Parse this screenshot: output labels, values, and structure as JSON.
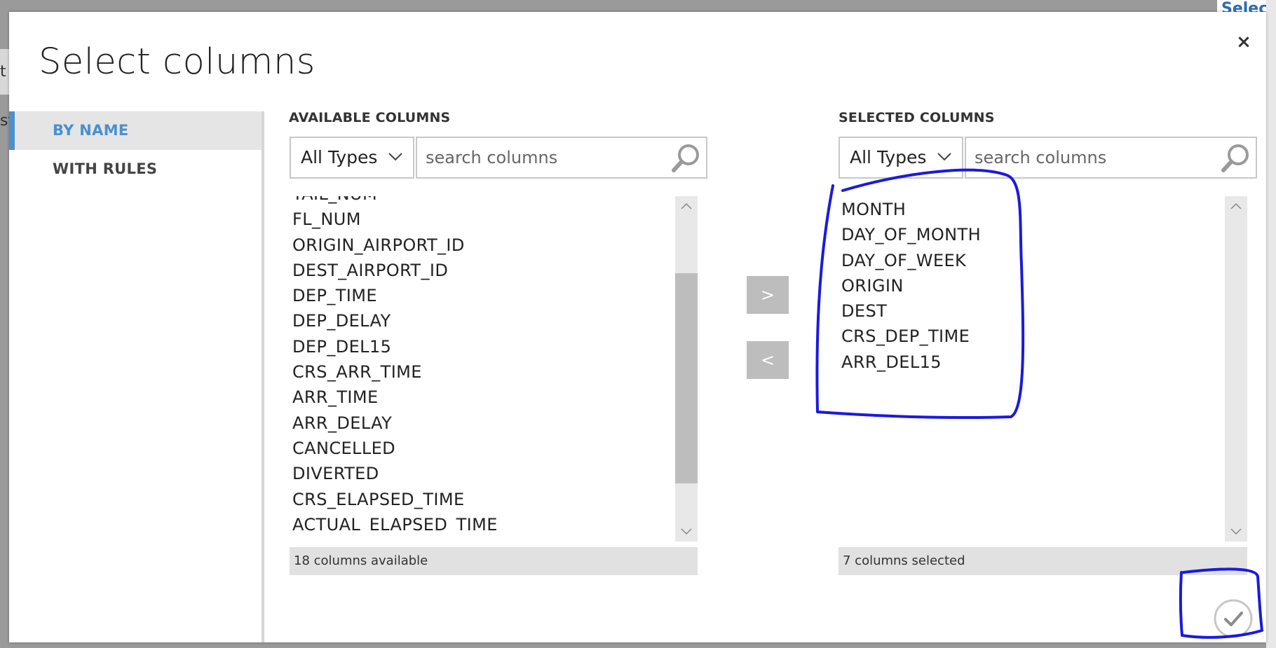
{
  "dialog": {
    "title": "Select columns",
    "close_label": "×"
  },
  "nav": {
    "items": [
      {
        "label": "BY NAME",
        "active": true
      },
      {
        "label": "WITH RULES",
        "active": false
      }
    ]
  },
  "available": {
    "label": "AVAILABLE COLUMNS",
    "type_filter": "All Types",
    "search_placeholder": "search columns",
    "items": [
      "TAIL_NUM",
      "FL_NUM",
      "ORIGIN_AIRPORT_ID",
      "DEST_AIRPORT_ID",
      "DEP_TIME",
      "DEP_DELAY",
      "DEP_DEL15",
      "CRS_ARR_TIME",
      "ARR_TIME",
      "ARR_DELAY",
      "CANCELLED",
      "DIVERTED",
      "CRS_ELAPSED_TIME",
      "ACTUAL_ELAPSED_TIME"
    ],
    "status": "18 columns available"
  },
  "selected": {
    "label": "SELECTED COLUMNS",
    "type_filter": "All Types",
    "search_placeholder": "search columns",
    "items": [
      "MONTH",
      "DAY_OF_MONTH",
      "DAY_OF_WEEK",
      "ORIGIN",
      "DEST",
      "CRS_DEP_TIME",
      "ARR_DEL15"
    ],
    "status": "7 columns selected"
  },
  "transfer": {
    "add_label": ">",
    "remove_label": "<"
  },
  "background": {
    "left_stub_1": "t",
    "left_stub_2": "sf",
    "right_stub": "Selecte"
  },
  "colors": {
    "accent": "#4a90cc",
    "annotation": "#1a1adf"
  },
  "icons": {
    "search": "search-icon",
    "chevron": "chevron-down-icon",
    "confirm": "check-circle-icon",
    "close": "close-icon"
  }
}
